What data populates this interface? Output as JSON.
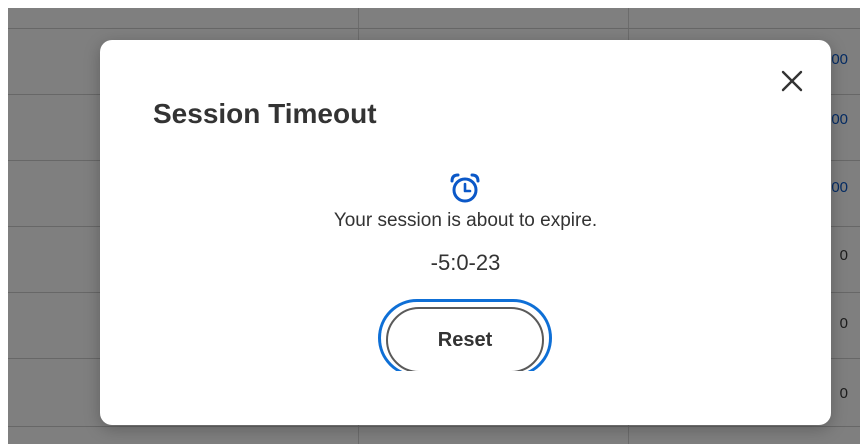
{
  "background_table": {
    "rows": [
      {
        "value": "00",
        "link": true
      },
      {
        "value": "00",
        "link": true
      },
      {
        "value": "00",
        "link": true
      },
      {
        "value": "0",
        "link": false
      },
      {
        "value": "0",
        "link": false
      },
      {
        "value": "0",
        "link": false
      }
    ]
  },
  "dialog": {
    "title": "Session Timeout",
    "close_icon": "close-icon",
    "clock_icon": "alarm-clock-icon",
    "message": "Your session is about to expire.",
    "countdown": "-5:0-23",
    "reset_label": "Reset"
  },
  "colors": {
    "accent": "#0e6fd6",
    "link": "#0b58c8",
    "text": "#333333"
  }
}
